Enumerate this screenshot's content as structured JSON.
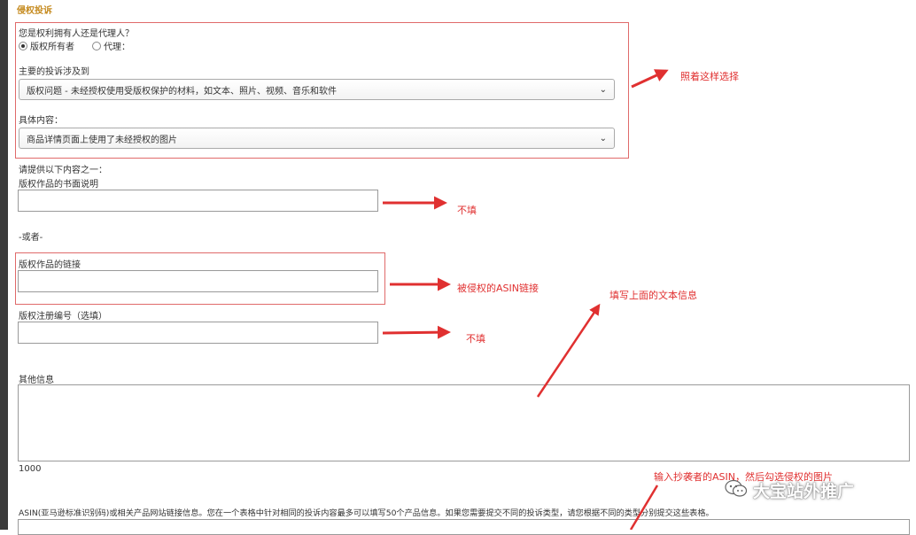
{
  "section_title": "侵权投诉",
  "owner_question": "您是权利拥有人还是代理人？",
  "owner_options": [
    {
      "label": "版权所有者",
      "checked": true
    },
    {
      "label": "代理：",
      "checked": false
    }
  ],
  "primary_issue_label": "主要的投诉涉及到",
  "primary_issue_value": "版权问题 - 未经授权使用受版权保护的材料，如文本、照片、视频、音乐和软件",
  "specific_label": "具体内容：",
  "specific_value": "商品详情页面上使用了未经授权的图片",
  "provide_one_label": "请提供以下内容之一：",
  "written_desc_label": "版权作品的书面说明",
  "or_label": "-或者-",
  "work_link_label": "版权作品的链接",
  "reg_no_label": "版权注册编号（选填）",
  "other_info_label": "其他信息",
  "char_count": "1000",
  "asin_desc": "ASIN(亚马逊标准识别码)或相关产品网站链接信息。您在一个表格中针对相同的投诉内容最多可以填写50个产品信息。如果您需要提交不同的投诉类型，请您根据不同的类型分别提交这些表格。",
  "annotations": {
    "choose_like_this": "照着这样选择",
    "not_fill_1": "不填",
    "infringed_asin_link": "被侵权的ASIN链接",
    "fill_text_above": "填写上面的文本信息",
    "not_fill_2": "不填",
    "enter_asin": "输入抄袭者的ASIN，然后勾选侵权的图片"
  },
  "watermark": "大宝站外推广",
  "colors": {
    "section_title": "#c58a1e",
    "annotation": "#e03030",
    "red_box": "#e06a6a"
  }
}
